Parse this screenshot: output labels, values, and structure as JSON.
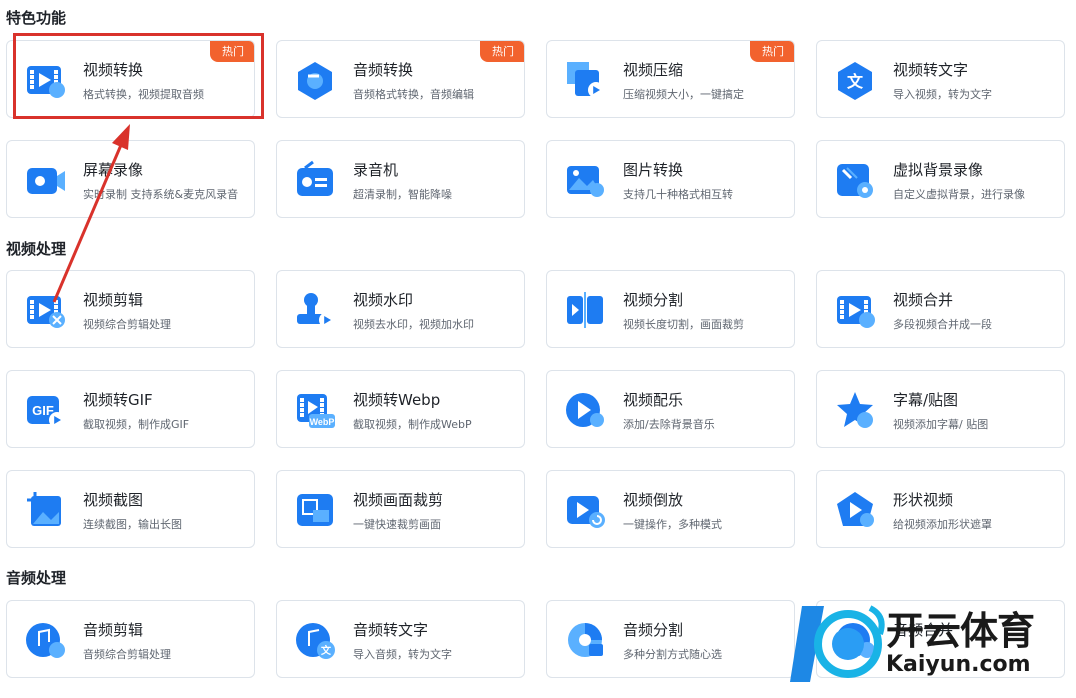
{
  "sections": {
    "featured": "特色功能",
    "video": "视频处理",
    "audio": "音频处理"
  },
  "cards": [
    {
      "title": "视频转换",
      "desc": "格式转换，视频提取音频",
      "badge": "热门",
      "icon": "video-convert-icon"
    },
    {
      "title": "音频转换",
      "desc": "音频格式转换，音频编辑",
      "badge": "热门",
      "icon": "audio-convert-icon"
    },
    {
      "title": "视频压缩",
      "desc": "压缩视频大小，一键搞定",
      "badge": "热门",
      "icon": "video-compress-icon"
    },
    {
      "title": "视频转文字",
      "desc": "导入视频，转为文字",
      "icon": "video-to-text-icon"
    },
    {
      "title": "屏幕录像",
      "desc": "实时录制 支持系统&麦克风录音",
      "icon": "screen-record-icon"
    },
    {
      "title": "录音机",
      "desc": "超清录制，智能降噪",
      "icon": "recorder-icon"
    },
    {
      "title": "图片转换",
      "desc": "支持几十种格式相互转",
      "icon": "image-convert-icon"
    },
    {
      "title": "虚拟背景录像",
      "desc": "自定义虚拟背景，进行录像",
      "icon": "virtual-bg-icon"
    },
    {
      "title": "视频剪辑",
      "desc": "视频综合剪辑处理",
      "icon": "video-edit-icon"
    },
    {
      "title": "视频水印",
      "desc": "视频去水印，视频加水印",
      "icon": "video-watermark-icon"
    },
    {
      "title": "视频分割",
      "desc": "视频长度切割，画面裁剪",
      "icon": "video-split-icon"
    },
    {
      "title": "视频合并",
      "desc": "多段视频合并成一段",
      "icon": "video-merge-icon"
    },
    {
      "title": "视频转GIF",
      "desc": "截取视频，制作成GIF",
      "icon": "video-to-gif-icon"
    },
    {
      "title": "视频转Webp",
      "desc": "截取视频，制作成WebP",
      "icon": "video-to-webp-icon"
    },
    {
      "title": "视频配乐",
      "desc": "添加/去除背景音乐",
      "icon": "video-music-icon"
    },
    {
      "title": "字幕/贴图",
      "desc": "视频添加字幕/ 贴图",
      "icon": "subtitle-sticker-icon"
    },
    {
      "title": "视频截图",
      "desc": "连续截图，输出长图",
      "icon": "video-screenshot-icon"
    },
    {
      "title": "视频画面裁剪",
      "desc": "一键快速裁剪画面",
      "icon": "video-crop-icon"
    },
    {
      "title": "视频倒放",
      "desc": "一键操作，多种模式",
      "icon": "video-reverse-icon"
    },
    {
      "title": "形状视频",
      "desc": "给视频添加形状遮罩",
      "icon": "shape-video-icon"
    },
    {
      "title": "音频剪辑",
      "desc": "音频综合剪辑处理",
      "icon": "audio-edit-icon"
    },
    {
      "title": "音频转文字",
      "desc": "导入音频，转为文字",
      "icon": "audio-to-text-icon"
    },
    {
      "title": "音频分割",
      "desc": "多种分割方式随心选",
      "icon": "audio-split-icon"
    },
    {
      "title": "音频合并",
      "desc": "",
      "icon": "audio-merge-icon"
    }
  ],
  "icon_text": {
    "gif": "GIF",
    "webp": "WebP",
    "wen": "文"
  },
  "watermark": {
    "title": "开云体育",
    "site": "Kaiyun.com"
  },
  "colors": {
    "accent": "#1e7cf2",
    "badge": "#f2622e",
    "highlight": "#d9322b"
  }
}
